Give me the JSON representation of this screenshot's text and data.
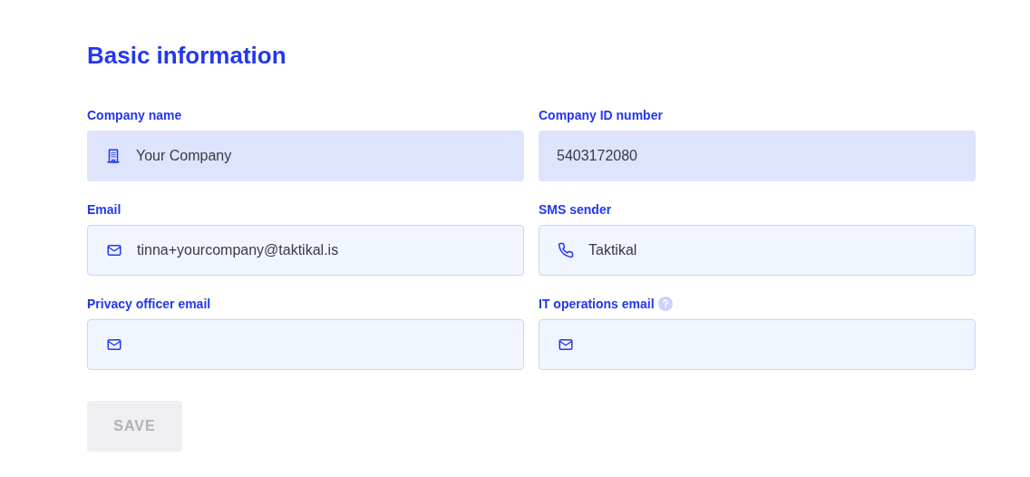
{
  "heading": "Basic information",
  "fields": [
    {
      "label": "Company name",
      "kind": "building",
      "value": "Your Company",
      "disabled": true,
      "help": false
    },
    {
      "label": "Company ID number",
      "kind": "plain",
      "value": "5403172080",
      "disabled": true,
      "help": false
    },
    {
      "label": "Email",
      "kind": "mail",
      "value": "tinna+yourcompany@taktikal.is",
      "disabled": false,
      "help": false
    },
    {
      "label": "SMS sender",
      "kind": "phone",
      "value": "Taktikal",
      "disabled": false,
      "help": false
    },
    {
      "label": "Privacy officer email",
      "kind": "mail",
      "disabled": false,
      "help": false
    },
    {
      "label": "IT operations email",
      "kind": "mail",
      "disabled": false,
      "help": true
    }
  ],
  "save_button": {
    "label": "SAVE",
    "disabled": true
  }
}
